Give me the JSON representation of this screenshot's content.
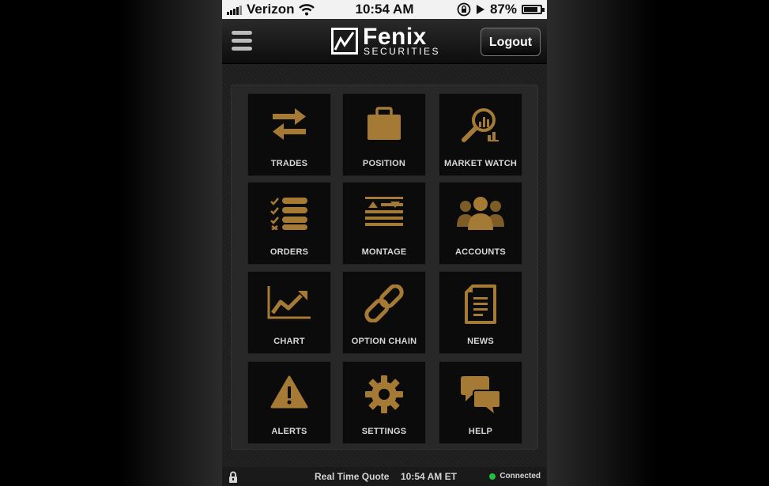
{
  "status_bar": {
    "carrier": "Verizon",
    "time": "10:54 AM",
    "battery": "87%",
    "battery_level": 0.87,
    "icons": [
      "signal-icon",
      "wifi-icon",
      "rotation-lock-icon",
      "play-icon",
      "battery-icon"
    ]
  },
  "nav": {
    "logo_name": "Fenix",
    "logo_sub": "SECURITIES",
    "logout_label": "Logout",
    "menu_icon": "hamburger-menu-icon"
  },
  "tiles": [
    {
      "label": "TRADES",
      "icon": "trades-arrows-icon"
    },
    {
      "label": "POSITION",
      "icon": "briefcase-icon"
    },
    {
      "label": "MARKET WATCH",
      "icon": "magnifier-chart-icon"
    },
    {
      "label": "ORDERS",
      "icon": "checklist-icon"
    },
    {
      "label": "MONTAGE",
      "icon": "montage-icon"
    },
    {
      "label": "ACCOUNTS",
      "icon": "people-icon"
    },
    {
      "label": "CHART",
      "icon": "line-chart-icon"
    },
    {
      "label": "OPTION CHAIN",
      "icon": "chain-link-icon"
    },
    {
      "label": "NEWS",
      "icon": "document-icon"
    },
    {
      "label": "ALERTS",
      "icon": "warning-icon"
    },
    {
      "label": "SETTINGS",
      "icon": "gear-icon"
    },
    {
      "label": "HELP",
      "icon": "chat-bubbles-icon"
    }
  ],
  "bottom_bar": {
    "quote_label": "Real Time Quote",
    "quote_time": "10:54 AM ET",
    "connection": "Connected"
  },
  "colors": {
    "accent_gold": "#a57a35",
    "connected_green": "#1fc43b"
  }
}
